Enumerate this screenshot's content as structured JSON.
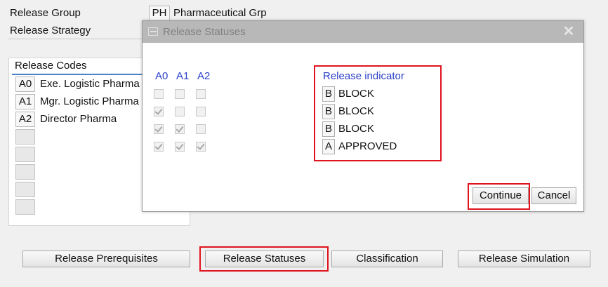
{
  "header": {
    "release_group_label": "Release Group",
    "release_group_code": "PH",
    "release_group_name": "Pharmaceutical Grp",
    "release_strategy_label": "Release Strategy"
  },
  "release_codes": {
    "title": "Release Codes",
    "items": [
      {
        "code": "A0",
        "name": "Exe. Logistic Pharma"
      },
      {
        "code": "A1",
        "name": "Mgr. Logistic Pharma"
      },
      {
        "code": "A2",
        "name": "Director Pharma"
      }
    ]
  },
  "dialog": {
    "title": "Release Statuses",
    "columns": [
      "A0",
      "A1",
      "A2"
    ],
    "checkbox_rows": [
      [
        false,
        false,
        false
      ],
      [
        true,
        false,
        false
      ],
      [
        true,
        true,
        false
      ],
      [
        true,
        true,
        true
      ]
    ],
    "indicator_header": "Release indicator",
    "indicators": [
      {
        "code": "B",
        "label": "BLOCK"
      },
      {
        "code": "B",
        "label": "BLOCK"
      },
      {
        "code": "B",
        "label": "BLOCK"
      },
      {
        "code": "A",
        "label": "APPROVED"
      }
    ],
    "continue_label": "Continue",
    "cancel_label": "Cancel"
  },
  "buttons": {
    "release_prerequisites": "Release Prerequisites",
    "release_statuses": "Release Statuses",
    "classification": "Classification",
    "release_simulation": "Release Simulation"
  },
  "colors": {
    "highlight": "#e0141e",
    "header_blue": "#2a40c8",
    "tab_underline": "#4a82c8"
  }
}
